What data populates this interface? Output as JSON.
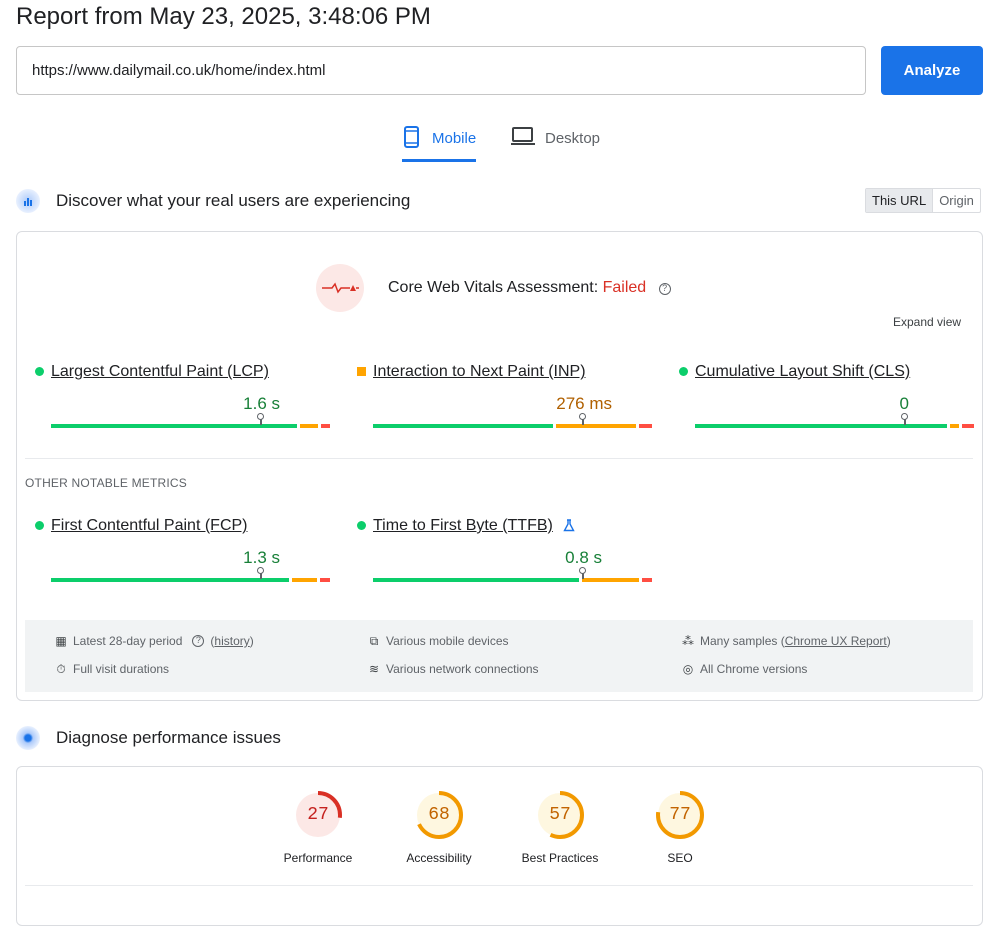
{
  "header": {
    "title": "Report from May 23, 2025, 3:48:06 PM"
  },
  "search": {
    "url": "https://www.dailymail.co.uk/home/index.html",
    "analyze_label": "Analyze"
  },
  "tabs": {
    "mobile": "Mobile",
    "desktop": "Desktop",
    "active": "Mobile"
  },
  "field": {
    "title": "Discover what your real users are experiencing",
    "toggle": {
      "this_url": "This URL",
      "origin": "Origin",
      "active": "This URL"
    },
    "assessment": {
      "label": "Core Web Vitals Assessment:",
      "status": "Failed",
      "status_color": "#d93025"
    },
    "expand_label": "Expand view",
    "metrics": [
      {
        "name": "Largest Contentful Paint (LCP)",
        "value": "1.6 s",
        "rating": "good"
      },
      {
        "name": "Interaction to Next Paint (INP)",
        "value": "276 ms",
        "rating": "needs-improvement"
      },
      {
        "name": "Cumulative Layout Shift (CLS)",
        "value": "0",
        "rating": "good"
      }
    ],
    "other_label": "OTHER NOTABLE METRICS",
    "other_metrics": [
      {
        "name": "First Contentful Paint (FCP)",
        "value": "1.3 s",
        "rating": "good"
      },
      {
        "name": "Time to First Byte (TTFB)",
        "value": "0.8 s",
        "rating": "good",
        "icon": "flask-icon"
      }
    ],
    "footer": {
      "period": "Latest 28-day period",
      "history": "history",
      "durations": "Full visit durations",
      "devices": "Various mobile devices",
      "network": "Various network connections",
      "samples_prefix": "Many samples (",
      "samples_link": "Chrome UX Report",
      "samples_suffix": ")",
      "versions": "All Chrome versions"
    }
  },
  "lab": {
    "title": "Diagnose performance issues",
    "scores": [
      {
        "label": "Performance",
        "score": 27,
        "color": "#d93025",
        "bg": "#fce8e6"
      },
      {
        "label": "Accessibility",
        "score": 68,
        "color": "#f29900",
        "bg": "#fef7e0"
      },
      {
        "label": "Best Practices",
        "score": 57,
        "color": "#f29900",
        "bg": "#fef7e0"
      },
      {
        "label": "SEO",
        "score": 77,
        "color": "#f29900",
        "bg": "#fef7e0"
      }
    ]
  },
  "colors": {
    "accent": "#1a73e8",
    "good": "#0cce6b",
    "average": "#ffa400",
    "poor": "#ff4e42"
  }
}
